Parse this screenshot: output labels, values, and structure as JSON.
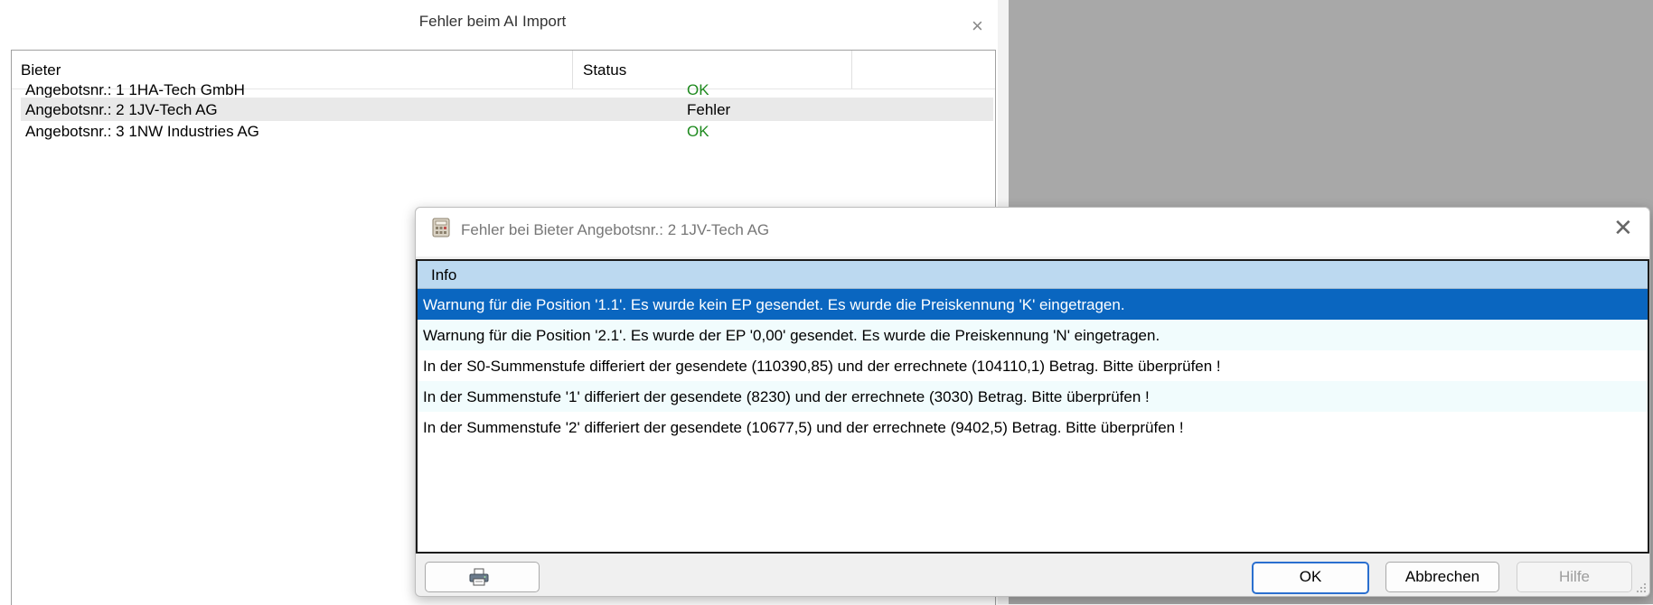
{
  "main": {
    "title": "Fehler beim AI Import",
    "close_glyph": "×",
    "columns": {
      "bieter": "Bieter",
      "status": "Status"
    },
    "rows": [
      {
        "bieter": "Angebotsnr.: 1 1HA-Tech GmbH",
        "status": "OK"
      },
      {
        "bieter": "Angebotsnr.: 2 1JV-Tech AG",
        "status": "Fehler"
      },
      {
        "bieter": "Angebotsnr.: 3 1NW Industries AG",
        "status": "OK"
      }
    ]
  },
  "dialog": {
    "title": "Fehler bei Bieter Angebotsnr.: 2 1JV-Tech AG",
    "icon": "calculator-icon",
    "close_glyph": "✕",
    "column_info": "Info",
    "messages": [
      "Warnung für die Position '1.1'. Es wurde kein EP gesendet. Es wurde die Preiskennung 'K' eingetragen.",
      "Warnung für die Position '2.1'. Es wurde der EP '0,00' gesendet. Es wurde die Preiskennung 'N' eingetragen.",
      "In der S0-Summenstufe differiert der gesendete (110390,85) und der errechnete (104110,1) Betrag. Bitte überprüfen !",
      "In der Summenstufe '1' differiert der gesendete (8230) und der errechnete (3030) Betrag. Bitte überprüfen !",
      "In der Summenstufe '2' differiert der gesendete (10677,5) und der errechnete (9402,5) Betrag. Bitte überprüfen !"
    ],
    "buttons": {
      "print_icon": "printer-icon",
      "ok": "OK",
      "cancel": "Abbrechen",
      "help": "Hilfe"
    }
  },
  "colors": {
    "selection": "#0a66c0",
    "header_blue": "#bcd9f0",
    "ok_green": "#1e8a1e",
    "desktop_gray": "#a8a8a8"
  }
}
